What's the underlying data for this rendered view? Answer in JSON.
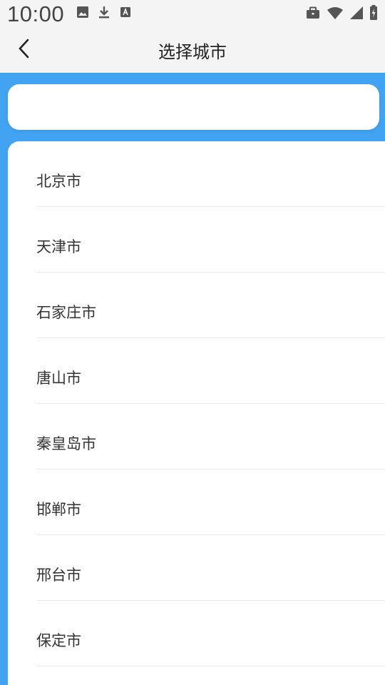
{
  "status_bar": {
    "time": "10:00",
    "left_icons": [
      "image-icon",
      "download-icon",
      "text-a-icon"
    ],
    "right_icons": [
      "briefcase-icon",
      "wifi-icon",
      "signal-icon",
      "battery-charging-icon"
    ]
  },
  "header": {
    "title": "选择城市",
    "back_icon": "chevron-left-icon"
  },
  "search": {
    "value": "",
    "placeholder": ""
  },
  "colors": {
    "accent_blue": "#42a3f2",
    "background": "#f4f4f4",
    "card": "#ffffff",
    "divider": "#ececec"
  },
  "cities": [
    {
      "label": "北京市"
    },
    {
      "label": "天津市"
    },
    {
      "label": "石家庄市"
    },
    {
      "label": "唐山市"
    },
    {
      "label": "秦皇岛市"
    },
    {
      "label": "邯郸市"
    },
    {
      "label": "邢台市"
    },
    {
      "label": "保定市"
    }
  ]
}
